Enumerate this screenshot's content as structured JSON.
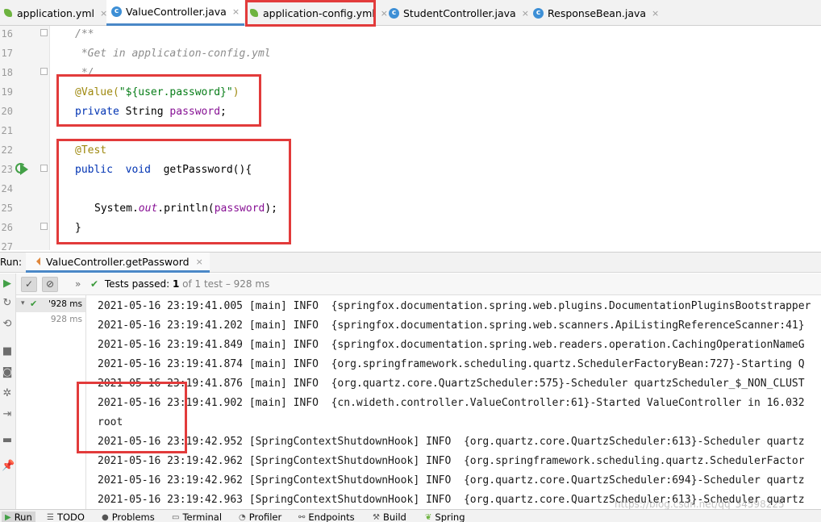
{
  "editor_tabs": [
    {
      "label": "application.yml",
      "icon": "yml-file-icon"
    },
    {
      "label": "ValueController.java",
      "icon": "java-class-icon",
      "active": true
    },
    {
      "label": "application-config.yml",
      "icon": "yml-file-icon"
    },
    {
      "label": "StudentController.java",
      "icon": "java-class-icon"
    },
    {
      "label": "ResponseBean.java",
      "icon": "java-class-icon"
    }
  ],
  "close_glyph": "×",
  "gutter": {
    "line_numbers": [
      "16",
      "17",
      "18",
      "19",
      "20",
      "21",
      "22",
      "23",
      "24",
      "25",
      "26",
      "27"
    ]
  },
  "code": {
    "l16": "/**",
    "l17": " *Get in application-config.yml",
    "l18": " */",
    "l19_annotation": "@Value(",
    "l19_string": "\"${user.password}\"",
    "l19_close": ")",
    "l20_keyword": "private",
    "l20_type": " String ",
    "l20_field": "password",
    "l20_end": ";",
    "l22": "@Test",
    "l23_public": "public",
    "l23_void": "void",
    "l23_method": "getPassword(){",
    "l25_system": "System.",
    "l25_out": "out",
    "l25_println": ".println(",
    "l25_field": "password",
    "l25_end": ");",
    "l26": "}"
  },
  "run_panel": {
    "label": "Run:",
    "tab_label": "ValueController.getPassword",
    "toolbar": {
      "chevron": "»",
      "passed_prefix": "Tests passed:",
      "passed_count": "1",
      "passed_suffix": "of 1 test – 928 ms"
    },
    "tree": [
      {
        "time": "928 ms",
        "prefix": "'"
      },
      {
        "time": "928 ms"
      }
    ],
    "console_lines": [
      "2021-05-16 23:19:41.005 [main] INFO  {springfox.documentation.spring.web.plugins.DocumentationPluginsBootstrapper",
      "2021-05-16 23:19:41.202 [main] INFO  {springfox.documentation.spring.web.scanners.ApiListingReferenceScanner:41}",
      "2021-05-16 23:19:41.849 [main] INFO  {springfox.documentation.spring.web.readers.operation.CachingOperationNameG",
      "2021-05-16 23:19:41.874 [main] INFO  {org.springframework.scheduling.quartz.SchedulerFactoryBean:727}-Starting Q",
      "2021-05-16 23:19:41.876 [main] INFO  {org.quartz.core.QuartzScheduler:575}-Scheduler quartzScheduler_$_NON_CLUST",
      "2021-05-16 23:19:41.902 [main] INFO  {cn.wideth.controller.ValueController:61}-Started ValueController in 16.032",
      "root",
      "2021-05-16 23:19:42.952 [SpringContextShutdownHook] INFO  {org.quartz.core.QuartzScheduler:613}-Scheduler quartz",
      "2021-05-16 23:19:42.962 [SpringContextShutdownHook] INFO  {org.springframework.scheduling.quartz.SchedulerFactor",
      "2021-05-16 23:19:42.962 [SpringContextShutdownHook] INFO  {org.quartz.core.QuartzScheduler:694}-Scheduler quartz",
      "2021-05-16 23:19:42.963 [SpringContextShutdownHook] INFO  {org.quartz.core.QuartzScheduler:613}-Scheduler quartz"
    ]
  },
  "bottom_bar": [
    {
      "label": "Run",
      "icon": "play-icon",
      "active": true
    },
    {
      "label": "TODO",
      "icon": "list-icon"
    },
    {
      "label": "Problems",
      "icon": "warning-icon"
    },
    {
      "label": "Terminal",
      "icon": "terminal-icon"
    },
    {
      "label": "Profiler",
      "icon": "profiler-icon"
    },
    {
      "label": "Endpoints",
      "icon": "endpoints-icon"
    },
    {
      "label": "Build",
      "icon": "hammer-icon"
    },
    {
      "label": "Spring",
      "icon": "spring-leaf-icon"
    }
  ],
  "watermark": "https://blog.csdn.net/qq_34598225",
  "colors": {
    "highlight_box": "#e23b3b",
    "keyword": "#0033b3",
    "annotation": "#9e880d",
    "string": "#067d17",
    "field": "#871094",
    "comment": "#8c8c8c",
    "pass_green": "#3c9a3c",
    "active_tab_underline": "#4a88c7"
  }
}
